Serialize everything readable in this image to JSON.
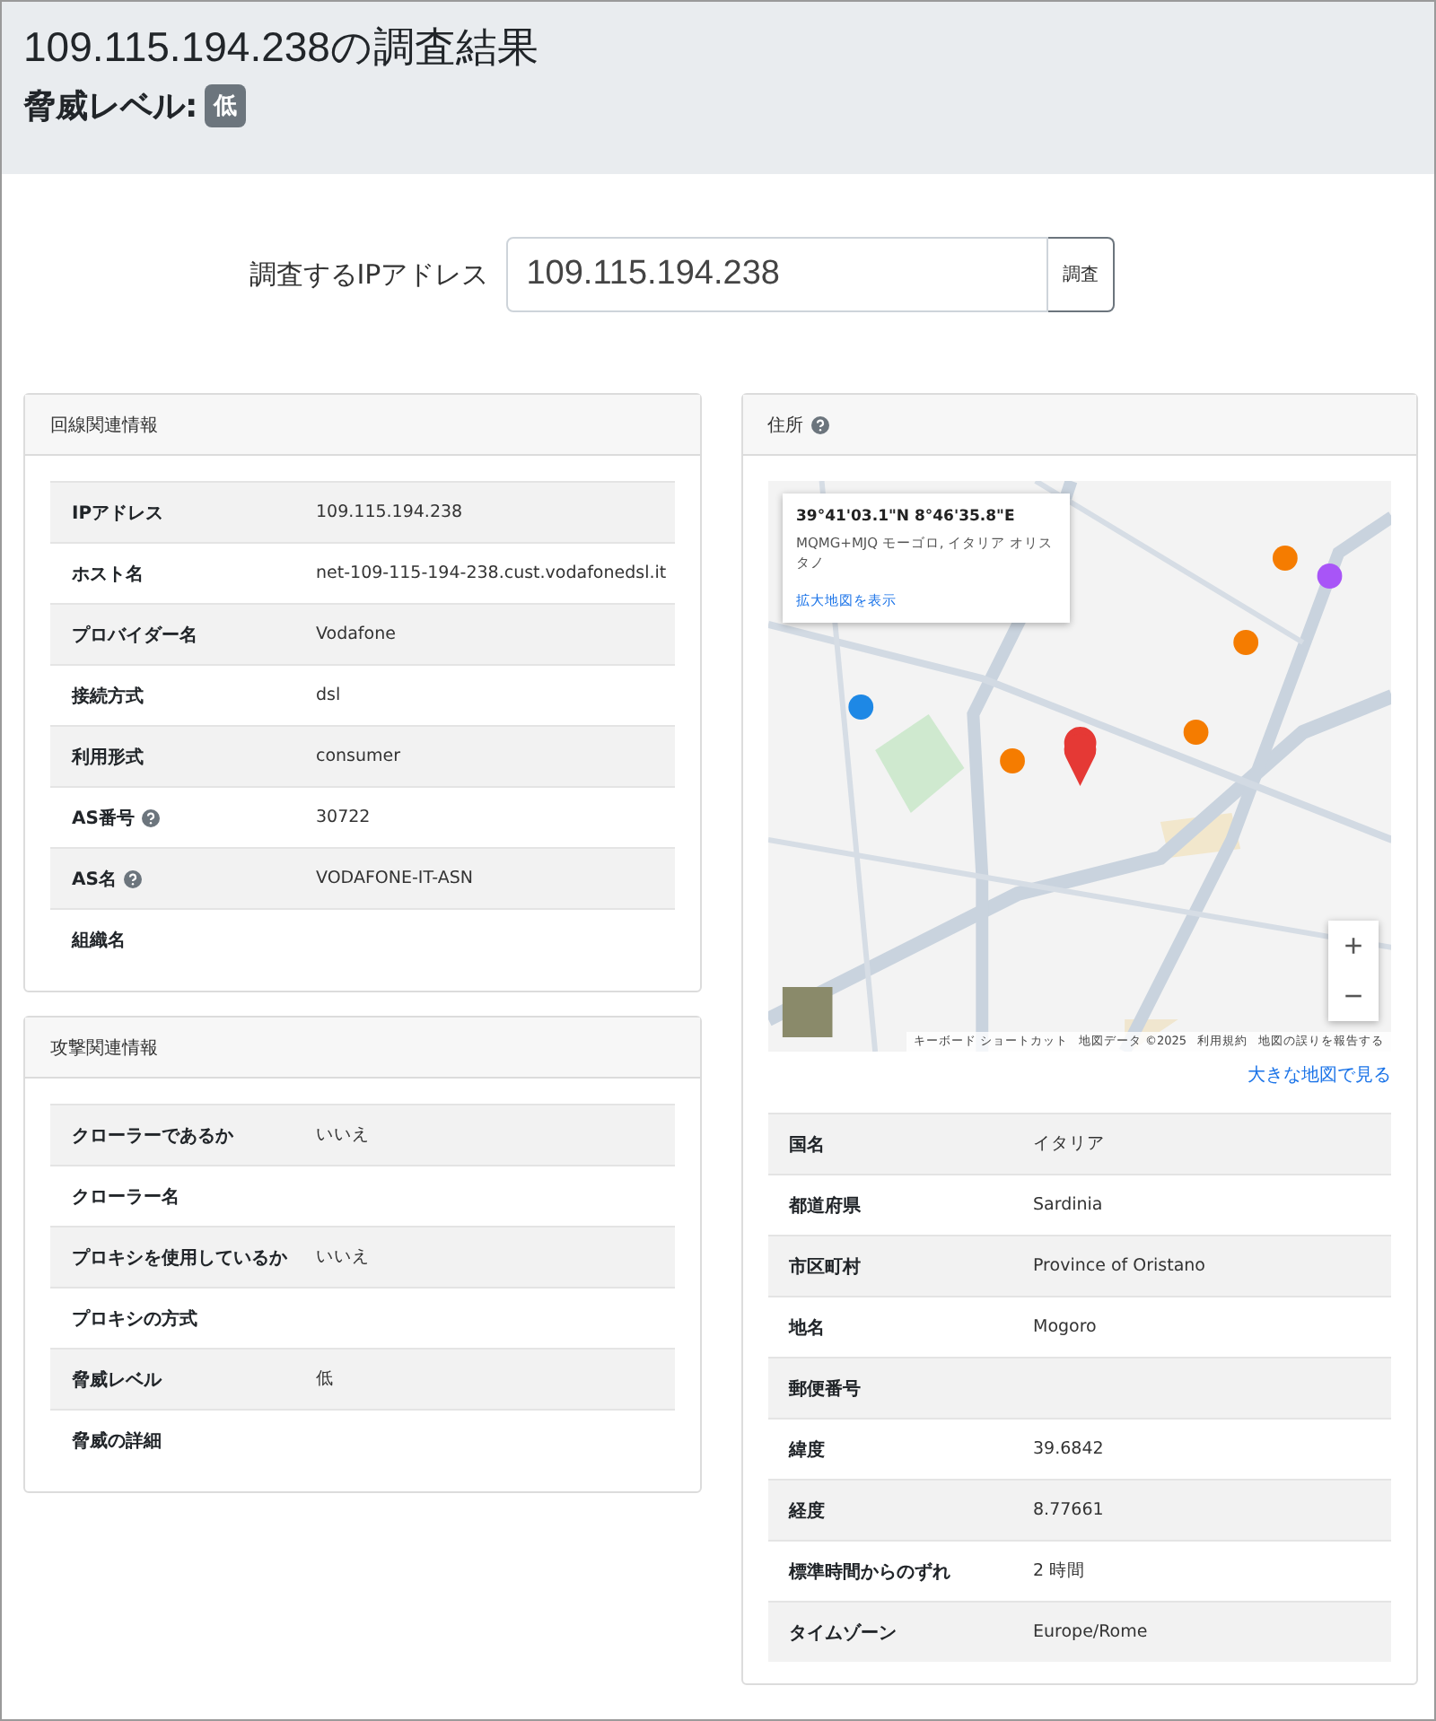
{
  "header": {
    "title": "109.115.194.238の調査結果",
    "threat_label": "脅威レベル:",
    "threat_badge": "低"
  },
  "search": {
    "label": "調査するIPアドレス",
    "value": "109.115.194.238",
    "button": "調査"
  },
  "line_info": {
    "title": "回線関連情報",
    "rows": [
      {
        "label": "IPアドレス",
        "value": "109.115.194.238",
        "help": false
      },
      {
        "label": "ホスト名",
        "value": "net-109-115-194-238.cust.vodafonedsl.it",
        "help": false
      },
      {
        "label": "プロバイダー名",
        "value": "Vodafone",
        "help": false
      },
      {
        "label": "接続方式",
        "value": "dsl",
        "help": false
      },
      {
        "label": "利用形式",
        "value": "consumer",
        "help": false
      },
      {
        "label": "AS番号",
        "value": "30722",
        "help": true
      },
      {
        "label": "AS名",
        "value": "VODAFONE-IT-ASN",
        "help": true
      },
      {
        "label": "組織名",
        "help": false
      }
    ]
  },
  "attack_info": {
    "title": "攻撃関連情報",
    "rows": [
      {
        "label": "クローラーであるか",
        "value": "いいえ",
        "help": false
      },
      {
        "label": "クローラー名",
        "help": false
      },
      {
        "label": "プロキシを使用しているか",
        "value": "いいえ",
        "help": false
      },
      {
        "label": "プロキシの方式",
        "help": false
      },
      {
        "label": "脅威レベル",
        "value": "低",
        "help": false
      },
      {
        "label": "脅威の詳細",
        "help": false
      }
    ]
  },
  "address": {
    "title": "住所",
    "help": true,
    "map": {
      "coords": "39°41'03.1\"N 8°46'35.8\"E",
      "place": "MQMG+MJQ モーゴロ, イタリア オリスタノ",
      "larger_link": "拡大地図を表示",
      "zoom_in": "+",
      "zoom_out": "−",
      "attribution": [
        "キーボード ショートカット",
        "地図データ ©2025",
        "利用規約",
        "地図の誤りを報告する"
      ]
    },
    "big_map_link": "大きな地図で見る",
    "rows": [
      {
        "label": "国名",
        "value": "イタリア",
        "help": false
      },
      {
        "label": "都道府県",
        "value": "Sardinia",
        "help": false
      },
      {
        "label": "市区町村",
        "value": "Province of Oristano",
        "help": false
      },
      {
        "label": "地名",
        "value": "Mogoro",
        "help": false
      },
      {
        "label": "郵便番号",
        "help": false
      },
      {
        "label": "緯度",
        "value": "39.6842",
        "help": false
      },
      {
        "label": "経度",
        "value": "8.77661",
        "help": false
      },
      {
        "label": "標準時間からのずれ",
        "value": "2 時間",
        "help": false
      },
      {
        "label": "タイムゾーン",
        "value": "Europe/Rome",
        "help": false
      }
    ]
  }
}
